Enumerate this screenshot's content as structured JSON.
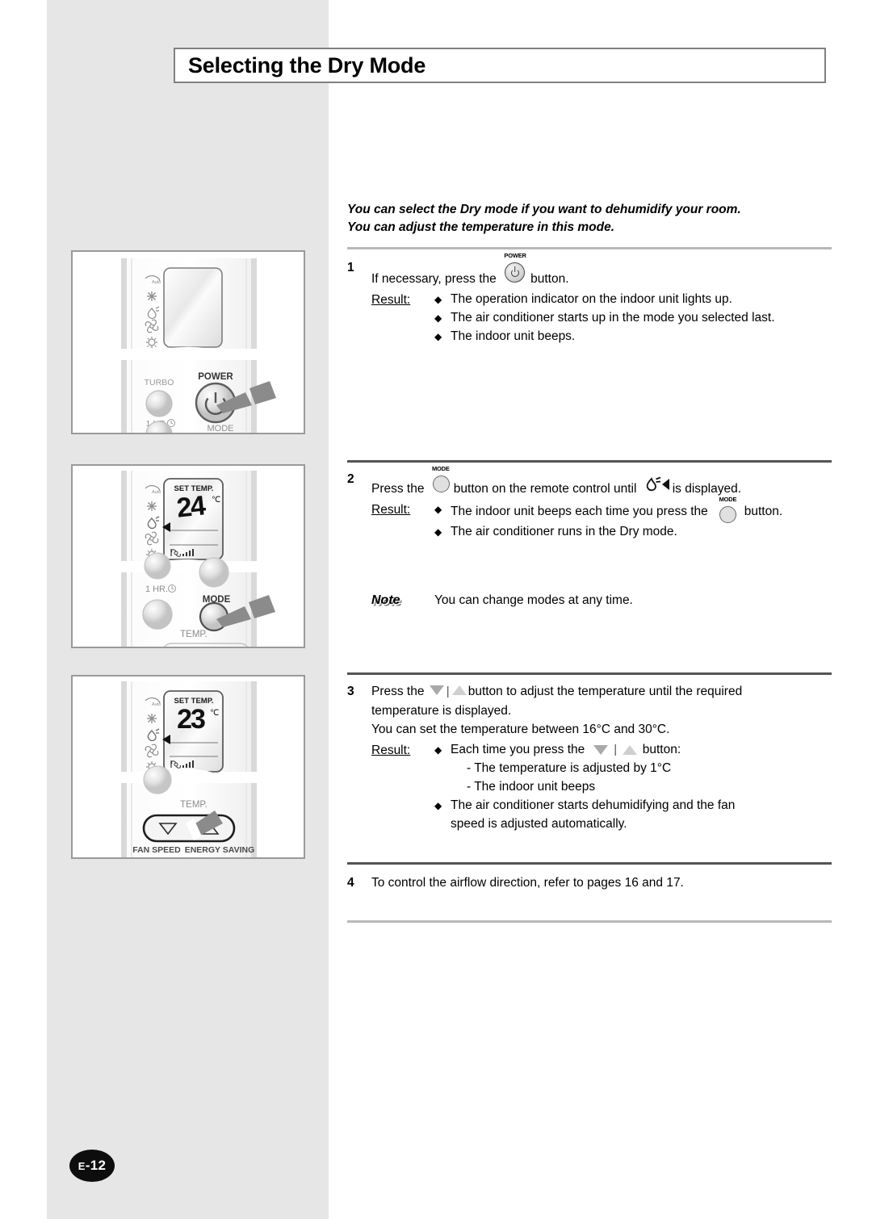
{
  "page": {
    "title": "Selecting the Dry Mode",
    "page_number": "E-12",
    "page_number_prefix": "E",
    "page_number_suffix": "-12"
  },
  "intro": {
    "line1": "You can select the Dry mode if you want to dehumidify your room.",
    "line2": "You can adjust the temperature in this mode."
  },
  "steps": [
    {
      "number": "1",
      "text_before": "If necessary, press the",
      "icon": "power-button-icon",
      "icon_caption": "POWER",
      "text_after": "button.",
      "result_label": "Result:",
      "results": [
        "The operation indicator on the indoor unit lights up.",
        "The air conditioner starts up in the mode you selected last.",
        "The indoor unit beeps."
      ]
    },
    {
      "number": "2",
      "text_before": "Press the",
      "icon": "mode-button-icon",
      "icon_caption": "MODE",
      "text_mid": "button on the remote control until",
      "display_icon": "dry-mode-droplet-icon",
      "text_after": "is displayed.",
      "result_label": "Result:",
      "results": [
        {
          "before": "The indoor unit beeps each time you press the",
          "icon": "mode-button-icon",
          "icon_caption": "MODE",
          "after": "button."
        },
        {
          "before": "The air conditioner runs in the Dry mode."
        }
      ]
    },
    {
      "number": "3",
      "text_before": "Press the",
      "icon_down": "temp-down-triangle-icon",
      "icon_sep": "|",
      "icon_up": "temp-up-triangle-icon",
      "text_after": "button to adjust the temperature until the required",
      "line2": "temperature is displayed.",
      "line3": "You can set the temperature between 16°C and 30°C.",
      "result_label": "Result:",
      "results": [
        {
          "before": "Each time you press the",
          "after": "button:",
          "sublines": [
            "- The temperature is adjusted by 1°C",
            "- The indoor unit beeps"
          ]
        },
        {
          "before": "The air conditioner starts dehumidifying and the fan",
          "line2": "speed is adjusted automatically."
        }
      ]
    },
    {
      "number": "4",
      "text": "To control the airflow direction, refer to pages 16 and 17."
    }
  ],
  "note": {
    "label": "Note",
    "text": "You can change modes at any time."
  },
  "illustrations": [
    {
      "name": "remote-power-button",
      "mode_icons": [
        "auto-arc-icon",
        "cool-snowflake-icon",
        "dry-droplet-icon",
        "fan-blades-icon",
        "heat-sun-icon"
      ],
      "mode_icon_label": "Auto",
      "buttons": [
        {
          "label": "TURBO"
        },
        {
          "label": "POWER",
          "highlighted": true
        },
        {
          "label": "1 HR."
        },
        {
          "label": "MODE"
        }
      ]
    },
    {
      "name": "remote-mode-button",
      "display": {
        "heading": "SET TEMP.",
        "value": "24",
        "unit": "℃"
      },
      "mode_icons": [
        "auto-arc-icon",
        "cool-snowflake-icon",
        "dry-droplet-icon",
        "fan-blades-icon",
        "heat-sun-icon"
      ],
      "buttons": [
        {
          "label": "1 HR."
        },
        {
          "label": "MODE",
          "highlighted": true
        },
        {
          "label": "TEMP."
        }
      ]
    },
    {
      "name": "remote-temp-buttons",
      "display": {
        "heading": "SET TEMP.",
        "value": "23",
        "unit": "℃"
      },
      "mode_icons": [
        "auto-arc-icon",
        "cool-snowflake-icon",
        "dry-droplet-icon",
        "fan-blades-icon",
        "heat-sun-icon"
      ],
      "buttons": [
        {
          "label": "TEMP."
        },
        {
          "label": "FAN SPEED"
        },
        {
          "label": "ENERGY SAVING"
        }
      ]
    }
  ],
  "colors": {
    "band": "#e6e6e6",
    "rule_light": "#b8b8b8",
    "rule_dark": "#545454",
    "box_border": "#9a9a9a",
    "badge": "#0d0d0d"
  }
}
